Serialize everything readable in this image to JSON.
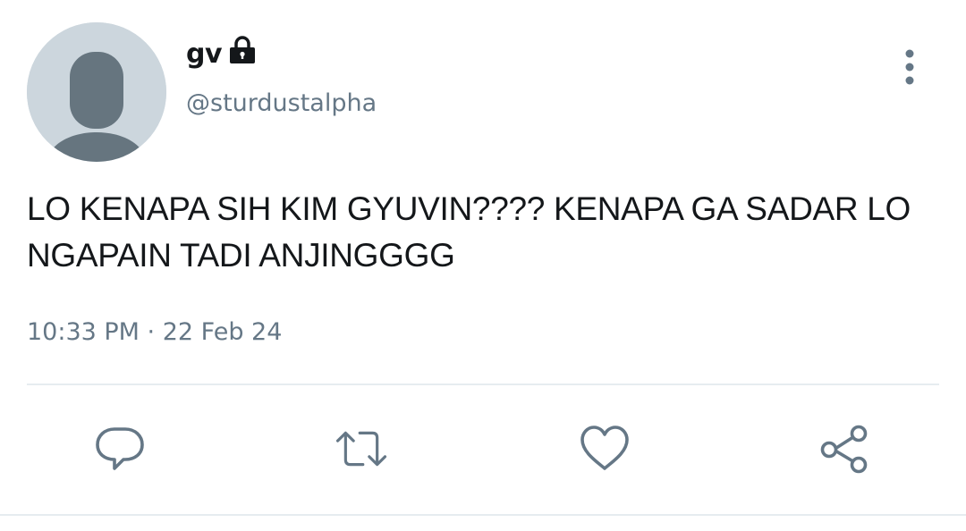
{
  "tweet": {
    "display_name": "gv",
    "handle": "@sturdustalpha",
    "text_lines": [
      "LO KENAPA SIH KIM GYUVIN???? KENAPA GA SADAR LO",
      "NGAPAIN TADI ANJINGGGG"
    ],
    "timestamp": "10:33 PM · 22 Feb 24",
    "protected": true
  },
  "icons": {
    "avatar": "default-avatar-icon",
    "lock": "lock-icon",
    "more": "more-vertical-icon",
    "reply": "reply-icon",
    "retweet": "retweet-icon",
    "like": "heart-icon",
    "share": "share-icon"
  },
  "colors": {
    "text": "#14171a",
    "secondary": "#657786",
    "avatar_bg": "#ccd6dd",
    "avatar_fg": "#66757f",
    "divider": "#e6ecf0"
  }
}
